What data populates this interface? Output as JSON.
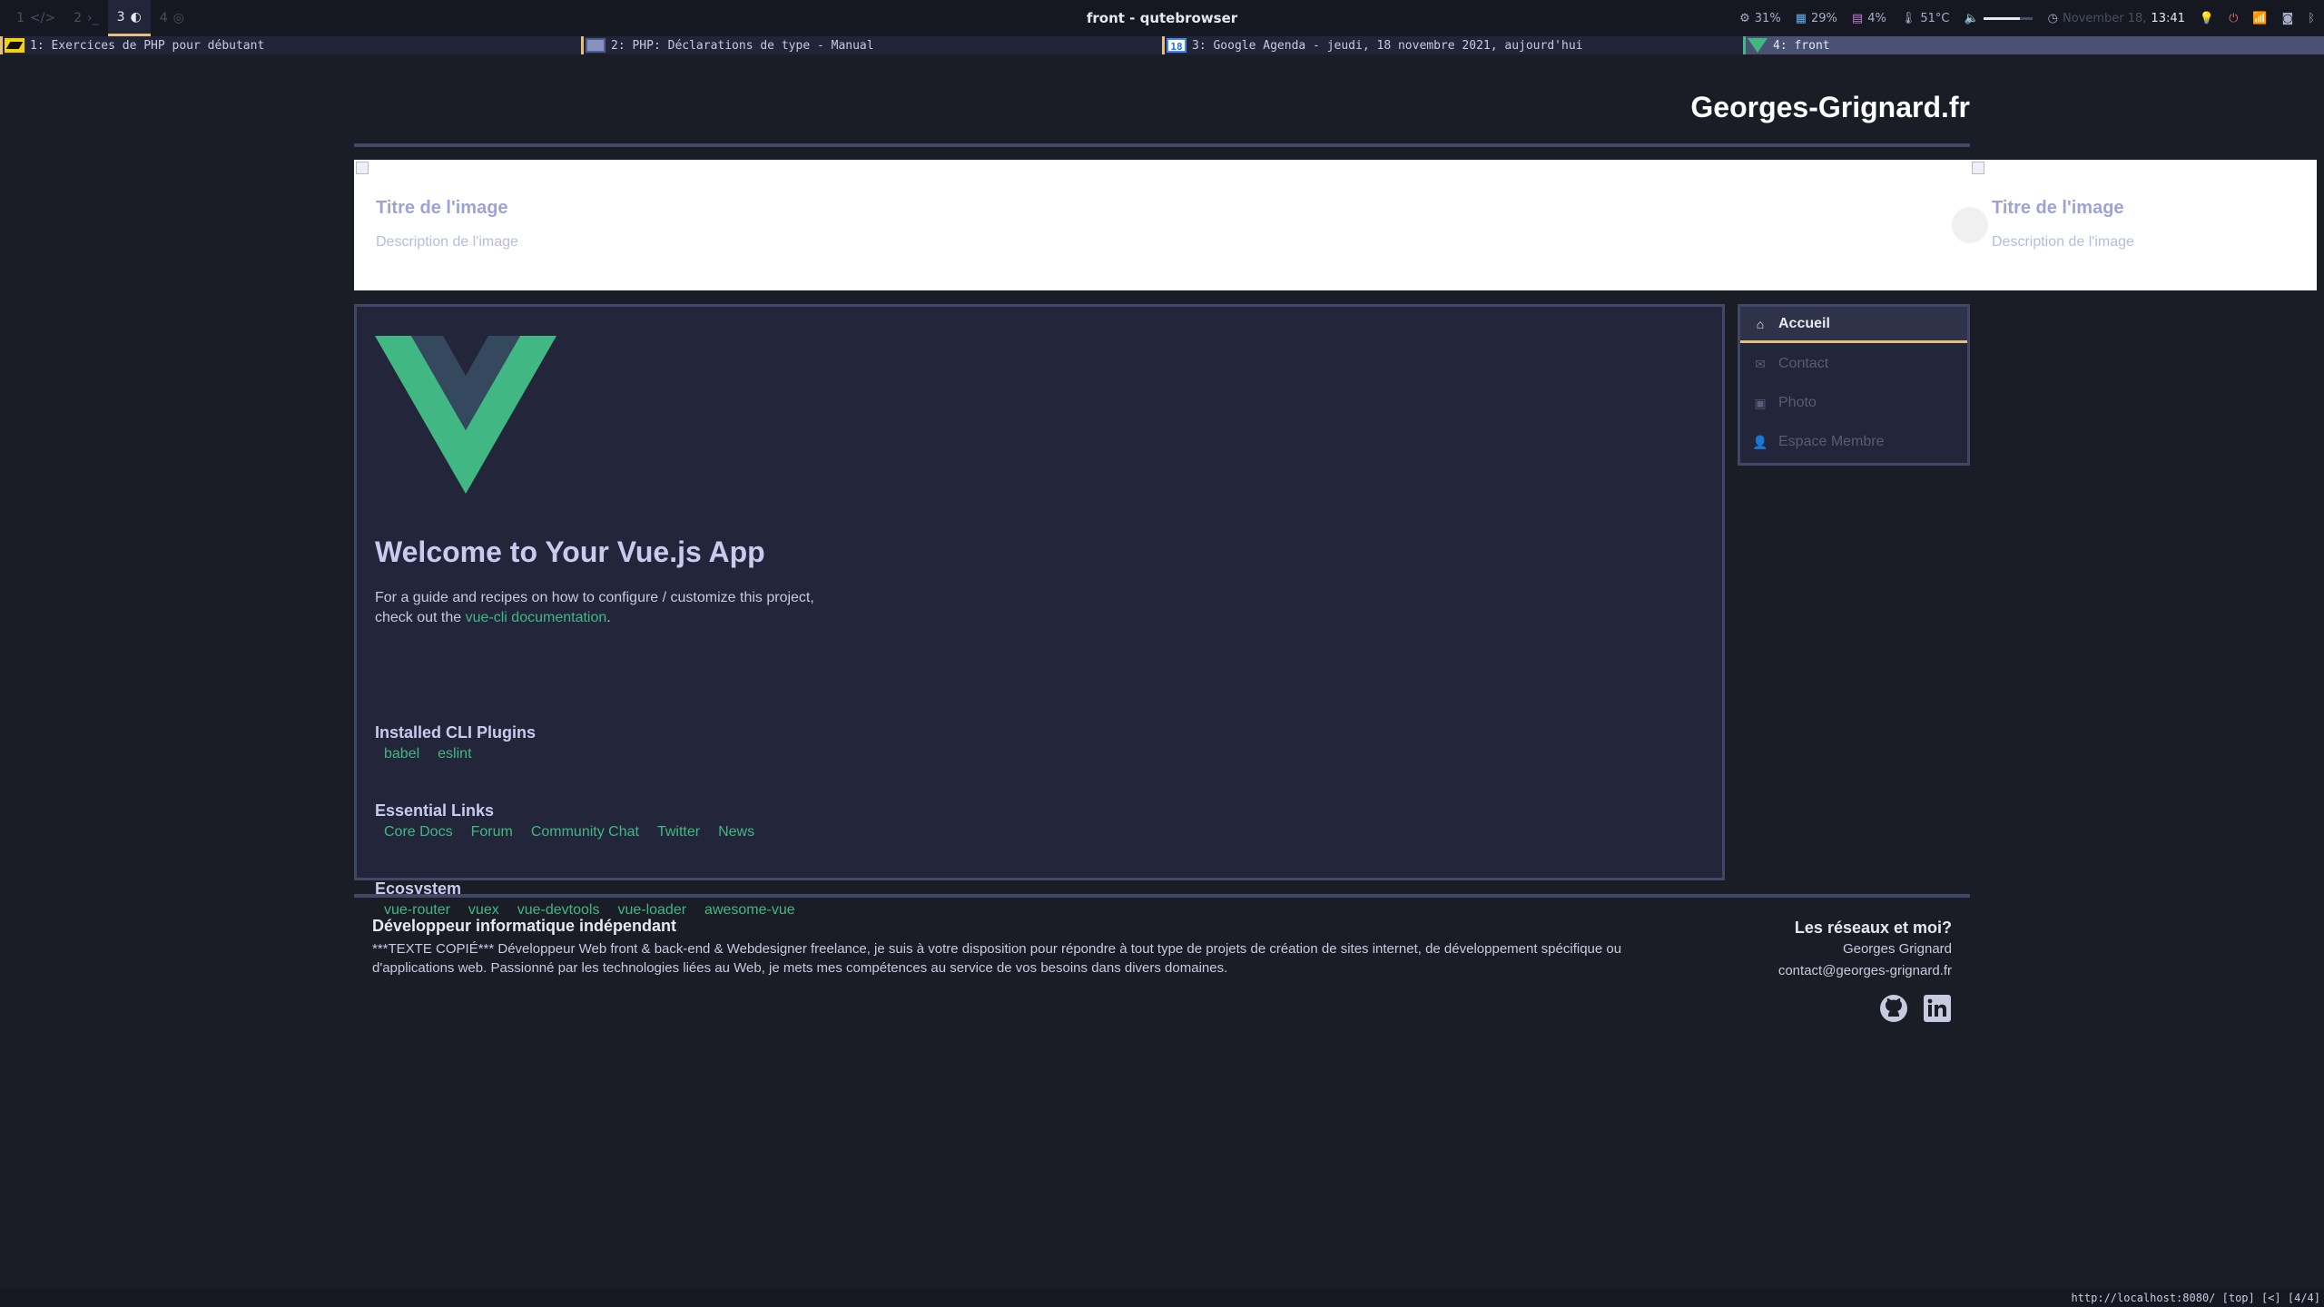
{
  "system_bar": {
    "workspaces": [
      {
        "num": "1",
        "glyph": "</>"
      },
      {
        "num": "2",
        "glyph": "›_"
      },
      {
        "num": "3",
        "glyph": "◐"
      },
      {
        "num": "4",
        "glyph": "◎"
      }
    ],
    "window_title": "front - qutebrowser",
    "status": {
      "cpu": "31%",
      "ram": "29%",
      "disk": "4%",
      "temp": "51°C",
      "volume_level": 0.75,
      "date": "November 18,",
      "time": "13:41"
    }
  },
  "tabs": [
    {
      "label": "1: Exercices de PHP pour débutant"
    },
    {
      "label": "2: PHP: Déclarations de type - Manual"
    },
    {
      "label": "3: Google Agenda - jeudi, 18 novembre 2021, aujourd'hui",
      "fav": "18"
    },
    {
      "label": "4: front"
    }
  ],
  "site": {
    "title": "Georges-Grignard.fr"
  },
  "carousel": {
    "slides": [
      {
        "title": "Titre de l'image",
        "description": "Description de l'image"
      },
      {
        "title": "Titre de l'image",
        "description": "Description de l'image"
      }
    ]
  },
  "main": {
    "welcome": "Welcome to Your Vue.js App",
    "intro_line1": "For a guide and recipes on how to configure / customize this project,",
    "intro_prefix": "check out the ",
    "intro_link": "vue-cli documentation",
    "intro_suffix": ".",
    "plugins_title": "Installed CLI Plugins",
    "plugins": [
      "babel",
      "eslint"
    ],
    "links_title": "Essential Links",
    "links": [
      "Core Docs",
      "Forum",
      "Community Chat",
      "Twitter",
      "News"
    ],
    "ecosystem_title": "Ecosystem",
    "ecosystem": [
      "vue-router",
      "vuex",
      "vue-devtools",
      "vue-loader",
      "awesome-vue"
    ]
  },
  "nav": {
    "items": [
      {
        "label": "Accueil",
        "icon": "home-icon",
        "active": true
      },
      {
        "label": "Contact",
        "icon": "envelope-icon",
        "active": false
      },
      {
        "label": "Photo",
        "icon": "images-icon",
        "active": false
      },
      {
        "label": "Espace Membre",
        "icon": "user-icon",
        "active": false
      }
    ]
  },
  "footer": {
    "left_title": "Développeur informatique indépendant",
    "left_text": "***TEXTE COPIÉ*** Développeur Web front & back-end & Webdesigner freelance, je suis à votre disposition pour répondre à tout type de projets de création de sites internet, de développement spécifique ou d'applications web. Passionné par les technologies liées au Web, je mets mes compétences au service de vos besoins dans divers domaines.",
    "right_title": "Les réseaux et moi?",
    "name": "Georges Grignard",
    "email": "contact@georges-grignard.fr"
  },
  "statusline": "http://localhost:8080/ [top] [<] [4/4]",
  "colors": {
    "background": "#1a1c26",
    "panel": "#23263a",
    "border": "#414766",
    "accent_green": "#41b883",
    "accent_yellow": "#e5c07b"
  }
}
